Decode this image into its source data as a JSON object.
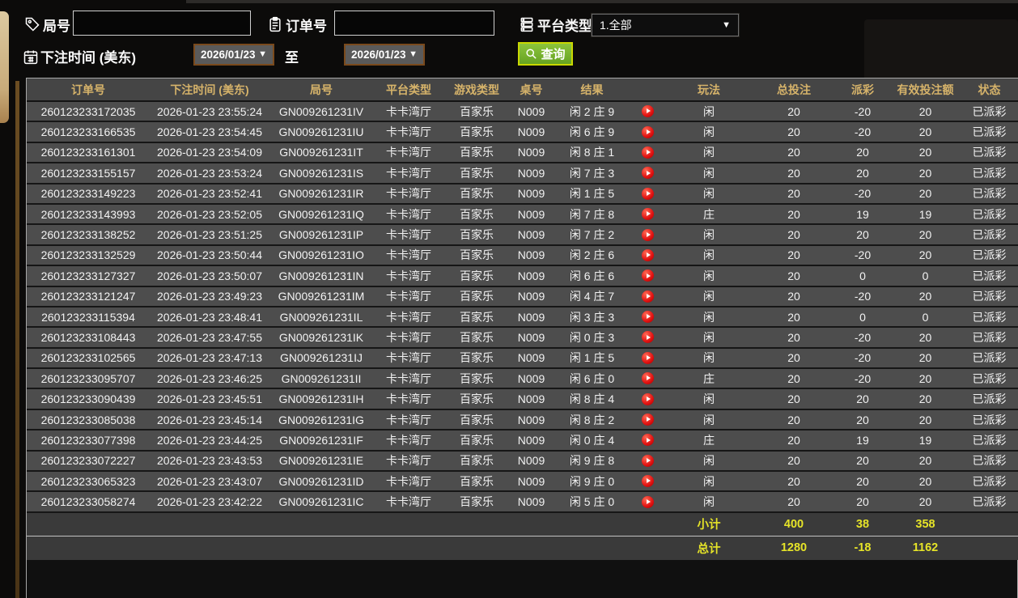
{
  "filters": {
    "round_label": "局号",
    "round_value": "",
    "order_label": "订单号",
    "order_value": "",
    "platform_label": "平台类型",
    "platform_value": "1.全部",
    "bet_time_label": "下注时间 (美东)",
    "date_from": "2026/01/23",
    "to_label": "至",
    "date_to": "2026/01/23",
    "query_label": "查询"
  },
  "table": {
    "columns": [
      "订单号",
      "下注时间 (美东)",
      "局号",
      "平台类型",
      "游戏类型",
      "桌号",
      "结果",
      "玩法",
      "总投注",
      "派彩",
      "有效投注额",
      "状态"
    ],
    "rows": [
      {
        "order_id": "260123233172035",
        "time": "2026-01-23 23:55:24",
        "round_id": "GN009261231IV",
        "platform": "卡卡湾厅",
        "game": "百家乐",
        "table_no": "N009",
        "result": "闲 2 庄 9",
        "play": "闲",
        "total_bet": "20",
        "payout": "-20",
        "valid_bet": "20",
        "status": "已派彩"
      },
      {
        "order_id": "260123233166535",
        "time": "2026-01-23 23:54:45",
        "round_id": "GN009261231IU",
        "platform": "卡卡湾厅",
        "game": "百家乐",
        "table_no": "N009",
        "result": "闲 6 庄 9",
        "play": "闲",
        "total_bet": "20",
        "payout": "-20",
        "valid_bet": "20",
        "status": "已派彩"
      },
      {
        "order_id": "260123233161301",
        "time": "2026-01-23 23:54:09",
        "round_id": "GN009261231IT",
        "platform": "卡卡湾厅",
        "game": "百家乐",
        "table_no": "N009",
        "result": "闲 8 庄 1",
        "play": "闲",
        "total_bet": "20",
        "payout": "20",
        "valid_bet": "20",
        "status": "已派彩"
      },
      {
        "order_id": "260123233155157",
        "time": "2026-01-23 23:53:24",
        "round_id": "GN009261231IS",
        "platform": "卡卡湾厅",
        "game": "百家乐",
        "table_no": "N009",
        "result": "闲 7 庄 3",
        "play": "闲",
        "total_bet": "20",
        "payout": "20",
        "valid_bet": "20",
        "status": "已派彩"
      },
      {
        "order_id": "260123233149223",
        "time": "2026-01-23 23:52:41",
        "round_id": "GN009261231IR",
        "platform": "卡卡湾厅",
        "game": "百家乐",
        "table_no": "N009",
        "result": "闲 1 庄 5",
        "play": "闲",
        "total_bet": "20",
        "payout": "-20",
        "valid_bet": "20",
        "status": "已派彩"
      },
      {
        "order_id": "260123233143993",
        "time": "2026-01-23 23:52:05",
        "round_id": "GN009261231IQ",
        "platform": "卡卡湾厅",
        "game": "百家乐",
        "table_no": "N009",
        "result": "闲 7 庄 8",
        "play": "庄",
        "total_bet": "20",
        "payout": "19",
        "valid_bet": "19",
        "status": "已派彩"
      },
      {
        "order_id": "260123233138252",
        "time": "2026-01-23 23:51:25",
        "round_id": "GN009261231IP",
        "platform": "卡卡湾厅",
        "game": "百家乐",
        "table_no": "N009",
        "result": "闲 7 庄 2",
        "play": "闲",
        "total_bet": "20",
        "payout": "20",
        "valid_bet": "20",
        "status": "已派彩"
      },
      {
        "order_id": "260123233132529",
        "time": "2026-01-23 23:50:44",
        "round_id": "GN009261231IO",
        "platform": "卡卡湾厅",
        "game": "百家乐",
        "table_no": "N009",
        "result": "闲 2 庄 6",
        "play": "闲",
        "total_bet": "20",
        "payout": "-20",
        "valid_bet": "20",
        "status": "已派彩"
      },
      {
        "order_id": "260123233127327",
        "time": "2026-01-23 23:50:07",
        "round_id": "GN009261231IN",
        "platform": "卡卡湾厅",
        "game": "百家乐",
        "table_no": "N009",
        "result": "闲 6 庄 6",
        "play": "闲",
        "total_bet": "20",
        "payout": "0",
        "valid_bet": "0",
        "status": "已派彩"
      },
      {
        "order_id": "260123233121247",
        "time": "2026-01-23 23:49:23",
        "round_id": "GN009261231IM",
        "platform": "卡卡湾厅",
        "game": "百家乐",
        "table_no": "N009",
        "result": "闲 4 庄 7",
        "play": "闲",
        "total_bet": "20",
        "payout": "-20",
        "valid_bet": "20",
        "status": "已派彩"
      },
      {
        "order_id": "260123233115394",
        "time": "2026-01-23 23:48:41",
        "round_id": "GN009261231IL",
        "platform": "卡卡湾厅",
        "game": "百家乐",
        "table_no": "N009",
        "result": "闲 3 庄 3",
        "play": "闲",
        "total_bet": "20",
        "payout": "0",
        "valid_bet": "0",
        "status": "已派彩"
      },
      {
        "order_id": "260123233108443",
        "time": "2026-01-23 23:47:55",
        "round_id": "GN009261231IK",
        "platform": "卡卡湾厅",
        "game": "百家乐",
        "table_no": "N009",
        "result": "闲 0 庄 3",
        "play": "闲",
        "total_bet": "20",
        "payout": "-20",
        "valid_bet": "20",
        "status": "已派彩"
      },
      {
        "order_id": "260123233102565",
        "time": "2026-01-23 23:47:13",
        "round_id": "GN009261231IJ",
        "platform": "卡卡湾厅",
        "game": "百家乐",
        "table_no": "N009",
        "result": "闲 1 庄 5",
        "play": "闲",
        "total_bet": "20",
        "payout": "-20",
        "valid_bet": "20",
        "status": "已派彩"
      },
      {
        "order_id": "260123233095707",
        "time": "2026-01-23 23:46:25",
        "round_id": "GN009261231II",
        "platform": "卡卡湾厅",
        "game": "百家乐",
        "table_no": "N009",
        "result": "闲 6 庄 0",
        "play": "庄",
        "total_bet": "20",
        "payout": "-20",
        "valid_bet": "20",
        "status": "已派彩"
      },
      {
        "order_id": "260123233090439",
        "time": "2026-01-23 23:45:51",
        "round_id": "GN009261231IH",
        "platform": "卡卡湾厅",
        "game": "百家乐",
        "table_no": "N009",
        "result": "闲 8 庄 4",
        "play": "闲",
        "total_bet": "20",
        "payout": "20",
        "valid_bet": "20",
        "status": "已派彩"
      },
      {
        "order_id": "260123233085038",
        "time": "2026-01-23 23:45:14",
        "round_id": "GN009261231IG",
        "platform": "卡卡湾厅",
        "game": "百家乐",
        "table_no": "N009",
        "result": "闲 8 庄 2",
        "play": "闲",
        "total_bet": "20",
        "payout": "20",
        "valid_bet": "20",
        "status": "已派彩"
      },
      {
        "order_id": "260123233077398",
        "time": "2026-01-23 23:44:25",
        "round_id": "GN009261231IF",
        "platform": "卡卡湾厅",
        "game": "百家乐",
        "table_no": "N009",
        "result": "闲 0 庄 4",
        "play": "庄",
        "total_bet": "20",
        "payout": "19",
        "valid_bet": "19",
        "status": "已派彩"
      },
      {
        "order_id": "260123233072227",
        "time": "2026-01-23 23:43:53",
        "round_id": "GN009261231IE",
        "platform": "卡卡湾厅",
        "game": "百家乐",
        "table_no": "N009",
        "result": "闲 9 庄 8",
        "play": "闲",
        "total_bet": "20",
        "payout": "20",
        "valid_bet": "20",
        "status": "已派彩"
      },
      {
        "order_id": "260123233065323",
        "time": "2026-01-23 23:43:07",
        "round_id": "GN009261231ID",
        "platform": "卡卡湾厅",
        "game": "百家乐",
        "table_no": "N009",
        "result": "闲 9 庄 0",
        "play": "闲",
        "total_bet": "20",
        "payout": "20",
        "valid_bet": "20",
        "status": "已派彩"
      },
      {
        "order_id": "260123233058274",
        "time": "2026-01-23 23:42:22",
        "round_id": "GN009261231IC",
        "platform": "卡卡湾厅",
        "game": "百家乐",
        "table_no": "N009",
        "result": "闲 5 庄 0",
        "play": "闲",
        "total_bet": "20",
        "payout": "20",
        "valid_bet": "20",
        "status": "已派彩"
      }
    ],
    "subtotal": {
      "label": "小计",
      "total_bet": "400",
      "payout": "38",
      "valid_bet": "358"
    },
    "total": {
      "label": "总计",
      "total_bet": "1280",
      "payout": "-18",
      "valid_bet": "1162"
    }
  },
  "colors": {
    "win_red": "#cc1433",
    "loss_green": "#70e018",
    "status_green": "#35e435",
    "summary_yellow": "#e6e428",
    "header_gold": "#d6b36a",
    "query_green": "#76b32e"
  }
}
